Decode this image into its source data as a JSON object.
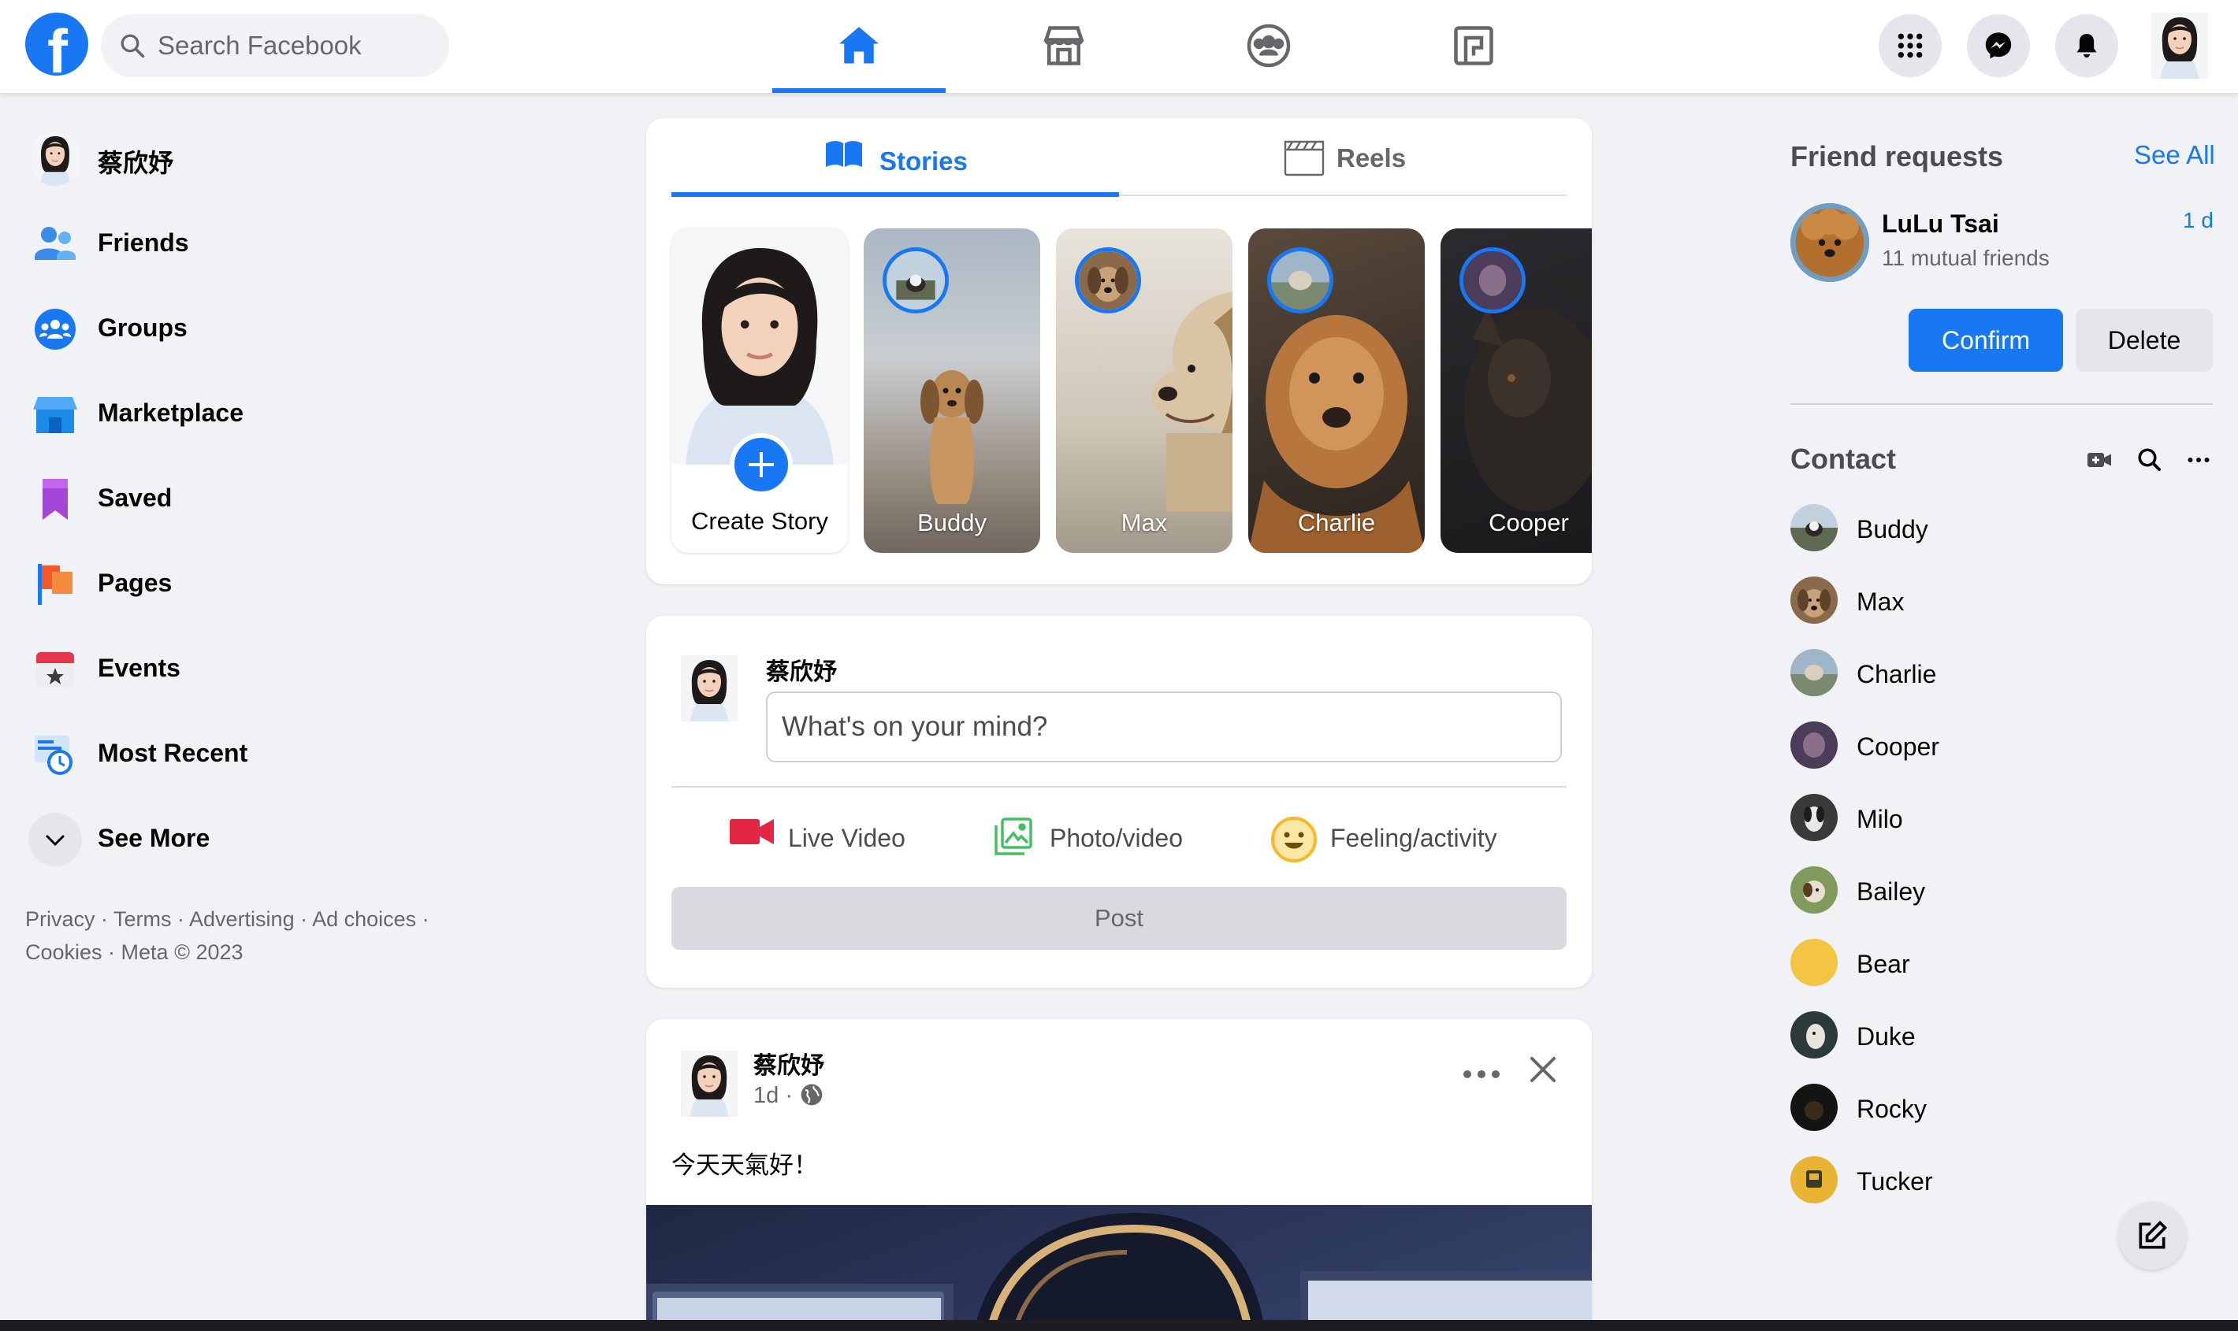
{
  "topbar": {
    "search_placeholder": "Search Facebook",
    "tabs": [
      "home",
      "marketplace",
      "groups",
      "gaming"
    ],
    "active_tab": "home"
  },
  "user": {
    "name": "蔡欣妤"
  },
  "sidebar": {
    "items": [
      {
        "label": "蔡欣妤",
        "icon": "user-avatar"
      },
      {
        "label": "Friends",
        "icon": "friends-icon"
      },
      {
        "label": "Groups",
        "icon": "groups-icon"
      },
      {
        "label": "Marketplace",
        "icon": "marketplace-icon"
      },
      {
        "label": "Saved",
        "icon": "saved-icon"
      },
      {
        "label": "Pages",
        "icon": "pages-icon"
      },
      {
        "label": "Events",
        "icon": "events-icon"
      },
      {
        "label": "Most Recent",
        "icon": "most-recent-icon"
      },
      {
        "label": "See More",
        "icon": "chevron-down-icon"
      }
    ],
    "footer": "Privacy · Terms · Advertising · Ad choices · Cookies · Meta © 2023"
  },
  "stories": {
    "tabs": [
      {
        "label": "Stories"
      },
      {
        "label": "Reels"
      }
    ],
    "create_label": "Create Story",
    "items": [
      {
        "name": "Buddy"
      },
      {
        "name": "Max"
      },
      {
        "name": "Charlie"
      },
      {
        "name": "Cooper"
      }
    ]
  },
  "composer": {
    "name": "蔡欣妤",
    "placeholder": "What's on your mind?",
    "actions": [
      {
        "label": "Live Video",
        "color": "#e42645"
      },
      {
        "label": "Photo/video",
        "color": "#45bd62"
      },
      {
        "label": "Feeling/activity",
        "color": "#f7b928"
      }
    ],
    "post_label": "Post"
  },
  "post": {
    "author": "蔡欣妤",
    "time": "1d",
    "separator": "·",
    "text": "今天天氣好！"
  },
  "friend_requests": {
    "title": "Friend requests",
    "see_all": "See All",
    "name": "LuLu Tsai",
    "mutual": "11 mutual friends",
    "time": "1 d",
    "confirm": "Confirm",
    "delete": "Delete"
  },
  "contacts": {
    "title": "Contact",
    "items": [
      {
        "name": "Buddy"
      },
      {
        "name": "Max"
      },
      {
        "name": "Charlie"
      },
      {
        "name": "Cooper"
      },
      {
        "name": "Milo"
      },
      {
        "name": "Bailey"
      },
      {
        "name": "Bear"
      },
      {
        "name": "Duke"
      },
      {
        "name": "Rocky"
      },
      {
        "name": "Tucker"
      }
    ]
  },
  "colors": {
    "brand": "#1877f2",
    "background": "#f0f2f5"
  }
}
